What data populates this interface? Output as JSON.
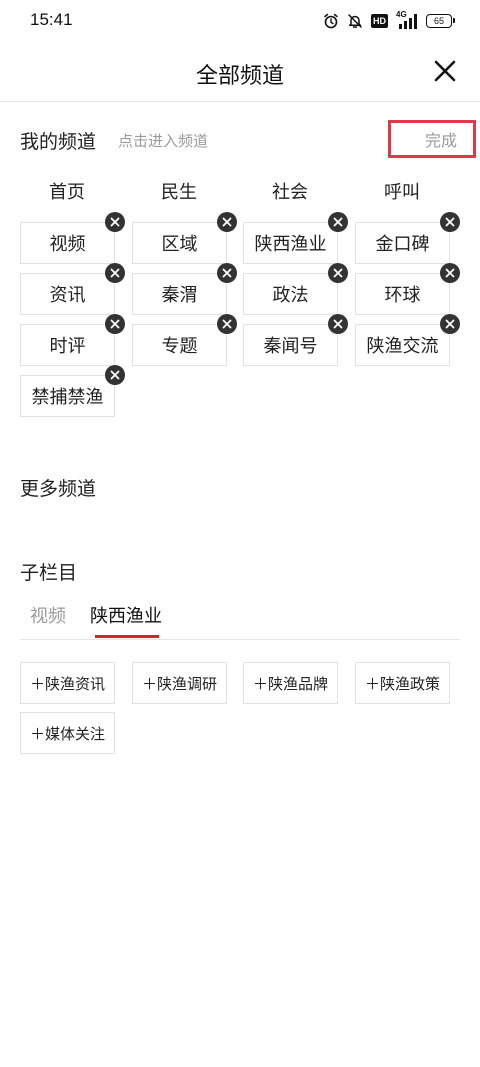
{
  "status_bar": {
    "time": "15:41",
    "hd_label": "HD",
    "network_label": "4G",
    "battery_level": "65"
  },
  "header": {
    "title": "全部频道"
  },
  "my_channels": {
    "title": "我的频道",
    "hint": "点击进入频道",
    "done_label": "完成",
    "fixed": [
      "首页",
      "民生",
      "社会",
      "呼叫"
    ],
    "editable": [
      "视频",
      "区域",
      "陕西渔业",
      "金口碑",
      "资讯",
      "秦渭",
      "政法",
      "环球",
      "时评",
      "专题",
      "秦闻号",
      "陕渔交流",
      "禁捕禁渔"
    ]
  },
  "more_channels": {
    "title": "更多频道"
  },
  "sub_columns": {
    "title": "子栏目",
    "tabs": [
      "视频",
      "陕西渔业"
    ],
    "active_tab": "陕西渔业",
    "items": [
      "＋陕渔资讯",
      "＋陕渔调研",
      "＋陕渔品牌",
      "＋陕渔政策",
      "＋媒体关注"
    ]
  },
  "colors": {
    "accent_red": "#d4252f",
    "highlight_border": "#e0384b",
    "muted_text": "#9b9b9b"
  }
}
